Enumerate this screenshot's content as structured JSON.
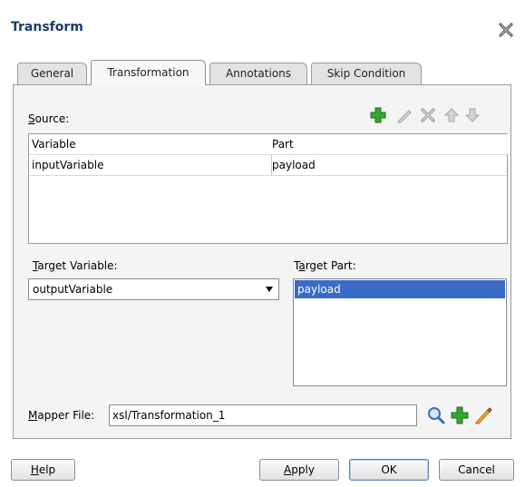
{
  "dialog": {
    "title": "Transform"
  },
  "tabs": [
    {
      "label": "General"
    },
    {
      "label": "Transformation"
    },
    {
      "label": "Annotations"
    },
    {
      "label": "Skip Condition"
    }
  ],
  "source": {
    "label_mnemonic": "S",
    "label_rest": "ource:",
    "columns": [
      "Variable",
      "Part"
    ],
    "rows": [
      {
        "variable": "inputVariable",
        "part": "payload"
      }
    ],
    "toolbar_icons": [
      "add-icon",
      "edit-icon",
      "delete-icon",
      "move-up-icon",
      "move-down-icon"
    ]
  },
  "target_variable": {
    "label_mnemonic": "T",
    "label_rest": "arget Variable:",
    "selected": "outputVariable"
  },
  "target_part": {
    "label_pre": "T",
    "label_mnemonic": "a",
    "label_rest": "rget Part:",
    "options": [
      "payload"
    ],
    "selected": "payload"
  },
  "mapper": {
    "label_mnemonic": "M",
    "label_rest": "apper File:",
    "value": "xsl/Transformation_1",
    "icons": [
      "search-icon",
      "add-icon",
      "edit-icon"
    ]
  },
  "buttons": {
    "help_mnemonic": "H",
    "help_rest": "elp",
    "apply_mnemonic": "A",
    "apply_rest": "pply",
    "ok": "OK",
    "cancel": "Cancel"
  },
  "colors": {
    "title": "#1b3b6e",
    "selection": "#3a6bc7",
    "add_green": "#2fa82f"
  }
}
